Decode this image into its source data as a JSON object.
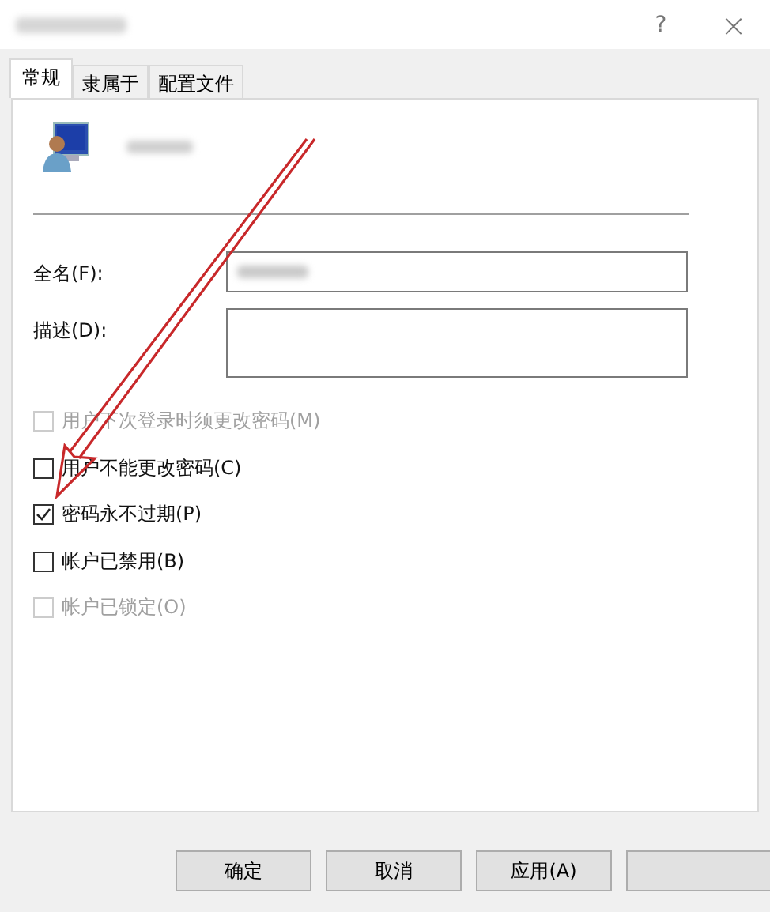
{
  "window": {
    "buttons": [
      {
        "kind": "help",
        "label": "?"
      },
      {
        "kind": "close",
        "label": "×"
      }
    ]
  },
  "tabs": [
    {
      "label": "常规",
      "selected": true
    },
    {
      "label": "隶属于",
      "selected": false
    },
    {
      "label": "配置文件",
      "selected": false
    }
  ],
  "fields": [
    {
      "label": "全名(F):",
      "kind": "line"
    },
    {
      "label": "描述(D):",
      "kind": "area"
    }
  ],
  "options": [
    {
      "label": "用户下次登录时须更改密码(M)",
      "checked": false,
      "disabled": true
    },
    {
      "label": "用户不能更改密码(C)",
      "checked": false,
      "disabled": false
    },
    {
      "label": "密码永不过期(P)",
      "checked": true,
      "disabled": false
    },
    {
      "label": "帐户已禁用(B)",
      "checked": false,
      "disabled": false
    },
    {
      "label": "帐户已锁定(O)",
      "checked": false,
      "disabled": true
    }
  ],
  "buttons": [
    {
      "label": "确定"
    },
    {
      "label": "取消"
    },
    {
      "label": "应用(A)"
    },
    {
      "kind": "hidden"
    }
  ],
  "annotations": [
    {
      "kind": "arrow"
    }
  ]
}
